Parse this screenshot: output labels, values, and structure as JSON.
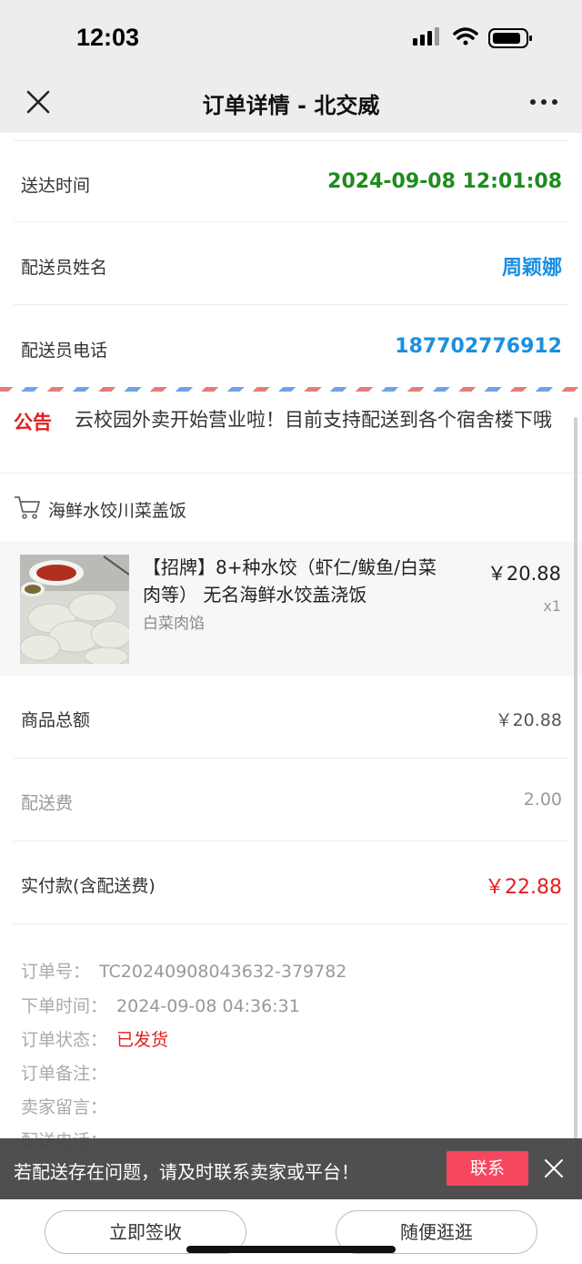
{
  "status_bar": {
    "time": "12:03"
  },
  "nav": {
    "title": "订单详情 - 北交威",
    "close_icon": "close-icon",
    "more_icon": "more-icon"
  },
  "delivery": {
    "time_label": "送达时间",
    "time_value": "2024-09-08 12:01:08",
    "courier_label": "配送员姓名",
    "courier_value": "周颖娜",
    "phone_label": "配送员电话",
    "phone_value": "18770277691 2"
  },
  "notice": {
    "tag": "公告",
    "text": "云校园外卖开始营业啦！目前支持配送到各个宿舍楼下哦"
  },
  "shop": {
    "name": "海鲜水饺川菜盖饭",
    "icon": "cart-icon"
  },
  "item": {
    "name": "【招牌】8+种水饺（虾仁/鲅鱼/白菜肉等） 无名海鲜水饺盖浇饭",
    "spec": "白菜肉馅",
    "price": "￥20.88",
    "qty": "x1"
  },
  "summary": {
    "goods_label": "商品总额",
    "goods_value": "￥20.88",
    "fee_label": "配送费",
    "fee_value": "2.00",
    "paid_label": "实付款(含配送费)",
    "paid_value": "￥22.88"
  },
  "order_meta": {
    "no_label": "订单号：",
    "no_value": "TC20240908043632-379782",
    "time_label": "下单时间：",
    "time_value": "2024-09-08 04:36:31",
    "status_label": "订单状态：",
    "status_value": "已发货",
    "remark_label": "订单备注：",
    "seller_label": "卖家留言：",
    "phone_label": "配送电话："
  },
  "toast": {
    "text": "若配送存在问题，请及时联系卖家或平台！",
    "button": "联系"
  },
  "bottom": {
    "confirm": "立即签收",
    "browse": "随便逛逛"
  },
  "colors": {
    "green": "#1e8c1e",
    "blue": "#1a8fe0",
    "red": "#e02020",
    "pink": "#f5475f"
  }
}
